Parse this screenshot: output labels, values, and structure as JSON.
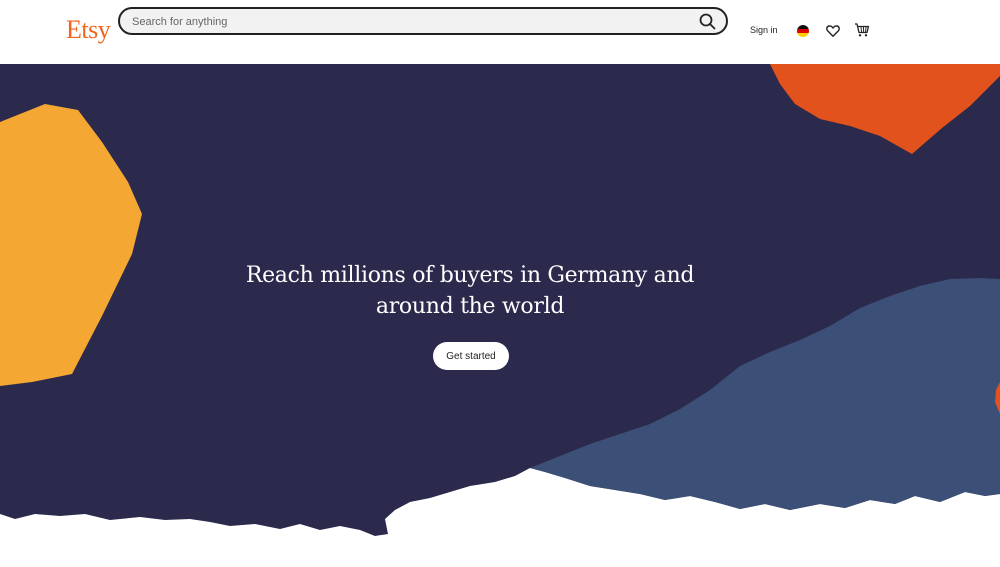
{
  "header": {
    "logo": "Etsy",
    "search": {
      "placeholder": "Search for anything",
      "value": ""
    },
    "search_icon": "search-icon",
    "signin_label": "Sign in",
    "flag_icon": "germany-flag-icon",
    "favorites_icon": "heart-icon",
    "cart_icon": "cart-icon"
  },
  "hero": {
    "headline": "Reach millions of buyers in Germany and around the world",
    "cta_label": "Get started"
  },
  "colors": {
    "brand": "#f1641e",
    "hero_navy": "#2b2a4c",
    "shape_yellow": "#f5a734",
    "shape_orange": "#e2521c",
    "shape_blue": "#3b4f77"
  }
}
